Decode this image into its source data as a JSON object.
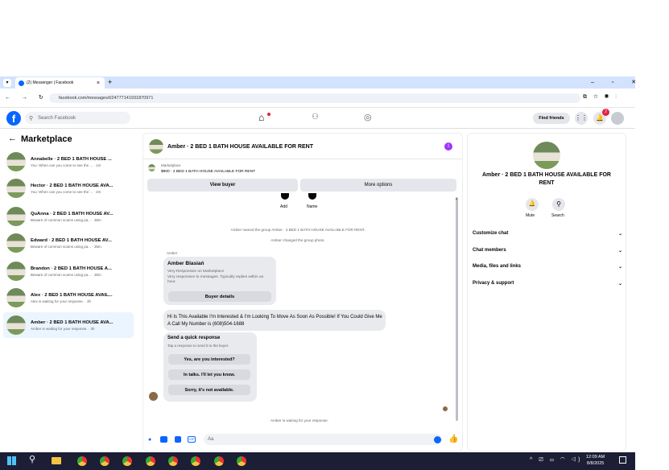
{
  "browser": {
    "tab_title": "(2) Messenger | Facebook",
    "url": "facebook.com/messages/t/24777141931870971"
  },
  "fb": {
    "search_placeholder": "Search Facebook",
    "find_friends": "Find friends",
    "notif_count": "2"
  },
  "left": {
    "title": "Marketplace",
    "items": [
      {
        "title": "Annabelle · 2 BED 1 BATH HOUSE ...",
        "sub": "You: When can you come to see the ... · 1m"
      },
      {
        "title": "Hector · 2 BED 1 BATH HOUSE AVA...",
        "sub": "You: When can you come to see the ... · 2m"
      },
      {
        "title": "QuAnna · 2 BED 1 BATH HOUSE AV...",
        "sub": "Beware of common scams using pa... · 35m"
      },
      {
        "title": "Edward · 2 BED 1 BATH HOUSE AV...",
        "sub": "Beware of common scams using pa... · 35m"
      },
      {
        "title": "Brandon · 2 BED 1 BATH HOUSE A...",
        "sub": "Beware of common scams using pa... · 35m"
      },
      {
        "title": "Alex · 2 BED 1 BATH HOUSE AVAIL...",
        "sub": "Alex is waiting for your response. · 3h"
      },
      {
        "title": "Amber · 2 BED 1 BATH HOUSE AVA...",
        "sub": "Amber is waiting for your response. · 3h"
      }
    ]
  },
  "chat": {
    "title": "Amber · 2 BED 1 BATH HOUSE AVAILABLE FOR RENT",
    "marketplace_label": "Marketplace",
    "listing": "$900 · 2 BED 1 BATH HOUSE AVAILABLE FOR RENT",
    "view_buyer": "View buyer",
    "more_options": "More options",
    "add": "Add",
    "name": "Name",
    "event1": "Amber named the group Amber · 2 BED 1 BATH HOUSE AVAILABLE FOR RENT.",
    "event2": "Amber changed the group photo.",
    "sender": "Amber",
    "card_name": "Amber Blasiań",
    "card_line1": "Very Responsive on Marketplace",
    "card_line2": "Very responsive to messages. Typically replies within an hour.",
    "buyer_details": "Buyer details",
    "message": "Hi Is This Available I'm Interested & I'm Looking To Move As Soon As Possible! If You Could Give Me A Call My Number is (608)504-1688",
    "quick_title": "Send a quick response",
    "quick_sub": "Tap a response to send it to the buyer.",
    "quick_replies": [
      "Yes, are you interested?",
      "In talks. I'll let you know.",
      "Sorry, it's not available."
    ],
    "waiting": "Amber is waiting for your response.",
    "input_placeholder": "Aa"
  },
  "details": {
    "title": "Amber · 2 BED 1 BATH HOUSE AVAILABLE FOR RENT",
    "mute": "Mute",
    "search": "Search",
    "sections": [
      "Customize chat",
      "Chat members",
      "Media, files and links",
      "Privacy & support"
    ]
  },
  "taskbar": {
    "time": "12:09 AM",
    "date": "8/8/2025"
  },
  "colors": {
    "accent": "#0866ff",
    "purple": "#a033ff",
    "taskbar": "#1b1e35"
  }
}
